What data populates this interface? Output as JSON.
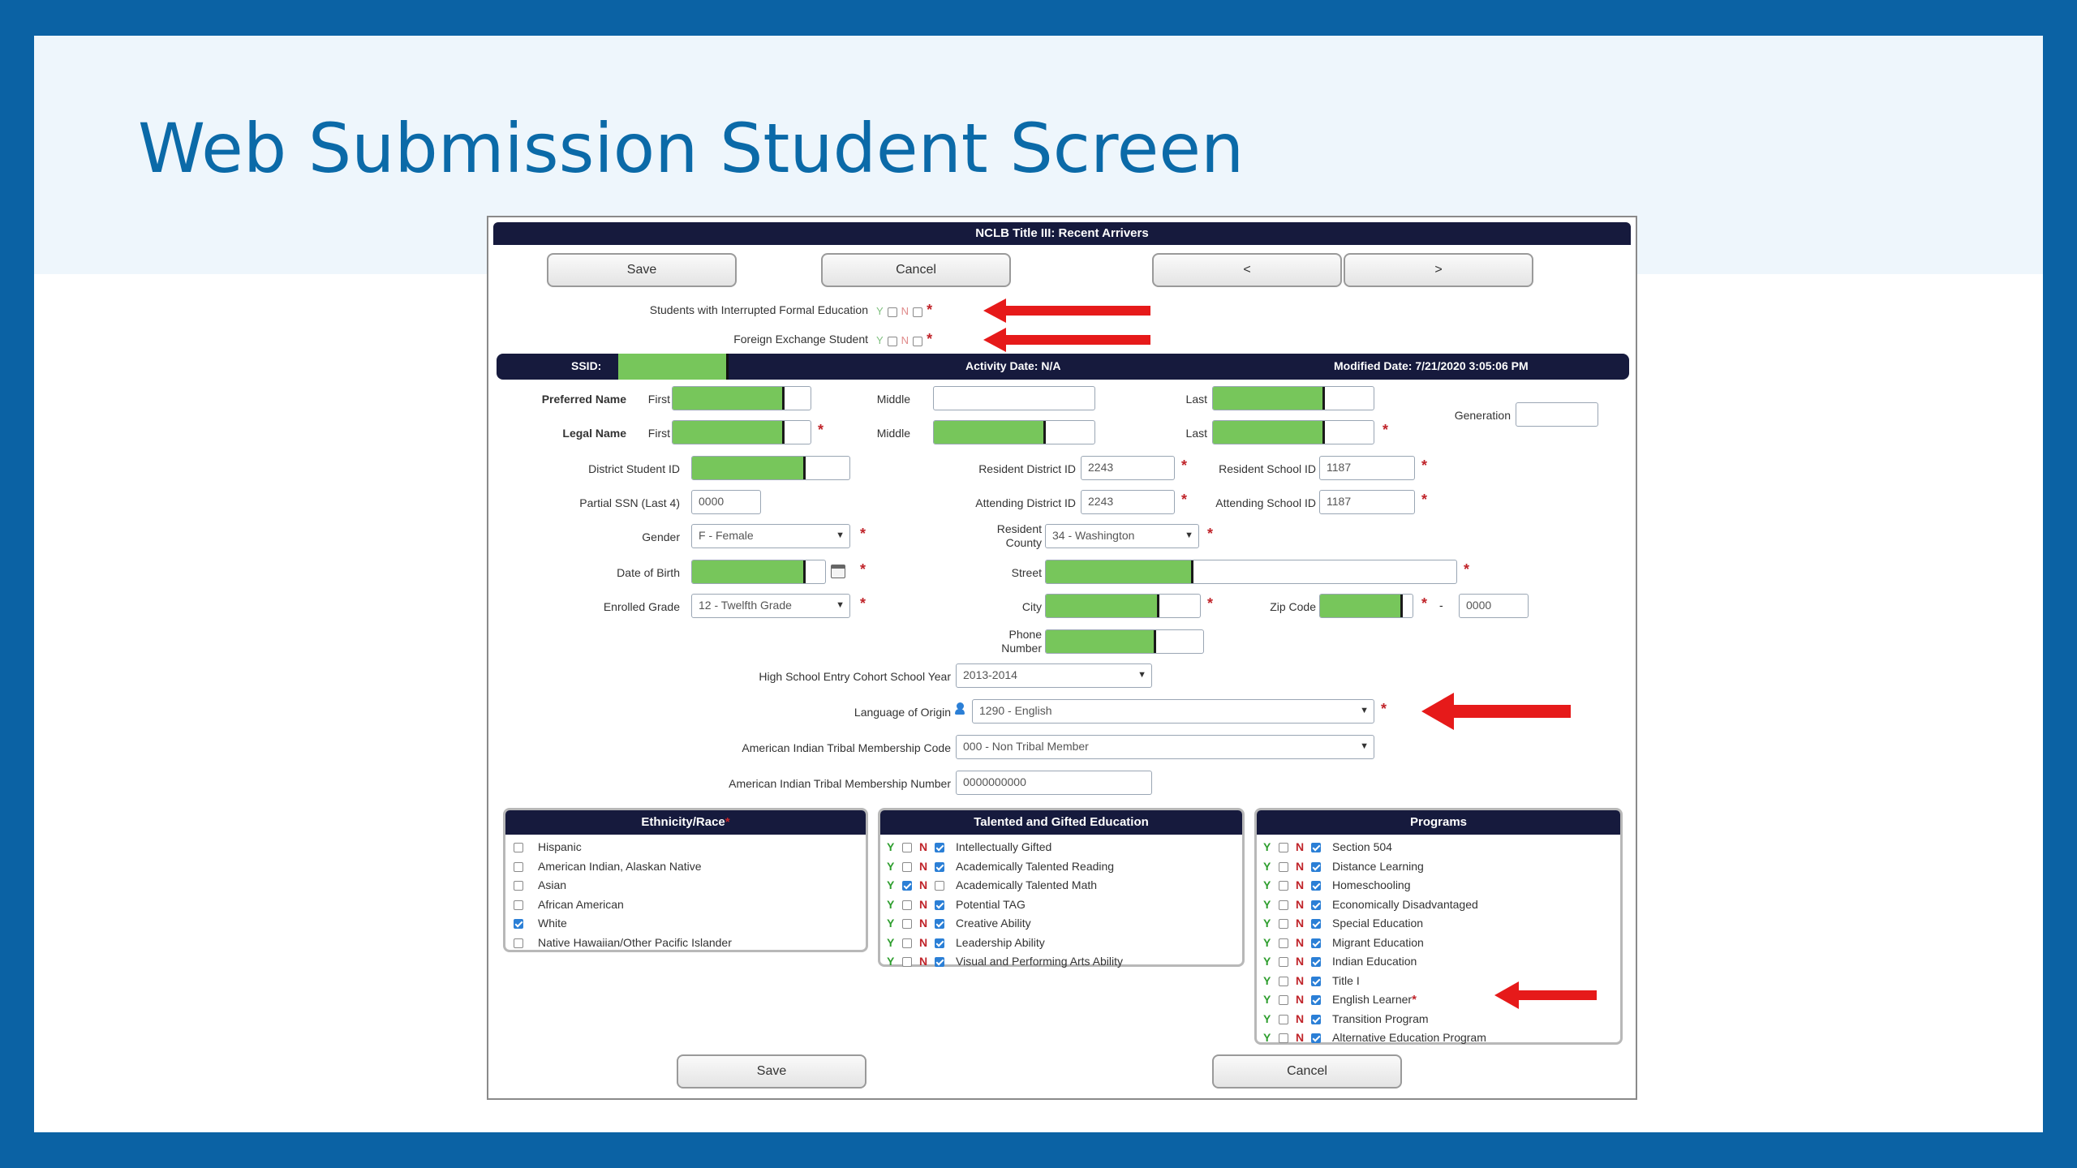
{
  "slide": {
    "title": "Web Submission Student Screen"
  },
  "form": {
    "title": "NCLB Title III: Recent Arrivers",
    "top_buttons": {
      "save": "Save",
      "cancel": "Cancel",
      "prev": "<",
      "next": ">"
    },
    "flags": [
      {
        "label": "Students with Interrupted Formal Education",
        "y": "Y",
        "n": "N",
        "req": "*"
      },
      {
        "label": "Foreign Exchange Student",
        "y": "Y",
        "n": "N",
        "req": "*"
      }
    ],
    "infobar": {
      "ssid_label": "SSID:",
      "activity_date": "Activity Date: N/A",
      "modified_date": "Modified Date: 7/21/2020 3:05:06 PM"
    },
    "fields": {
      "preferred_name_label": "Preferred Name",
      "legal_name_label": "Legal Name",
      "first": "First",
      "middle": "Middle",
      "last": "Last",
      "generation": "Generation",
      "district_student_id": "District Student ID",
      "partial_ssn": "Partial SSN (Last 4)",
      "partial_ssn_value": "0000",
      "gender": "Gender",
      "gender_value": "F - Female",
      "dob": "Date of Birth",
      "enrolled_grade": "Enrolled Grade",
      "enrolled_grade_value": "12 - Twelfth Grade",
      "resident_district_id": "Resident District ID",
      "resident_district_id_value": "2243",
      "attending_district_id": "Attending District ID",
      "attending_district_id_value": "2243",
      "resident_county_1": "Resident",
      "resident_county_2": "County",
      "resident_county_value": "34 - Washington",
      "street": "Street",
      "city": "City",
      "phone_1": "Phone",
      "phone_2": "Number",
      "resident_school_id": "Resident School ID",
      "resident_school_id_value": "1187",
      "attending_school_id": "Attending School ID",
      "attending_school_id_value": "1187",
      "zip_code": "Zip Code",
      "zip_dash": "-",
      "zip_ext_value": "0000",
      "hs_cohort": "High School Entry Cohort School Year",
      "hs_cohort_value": "2013-2014",
      "language": "Language of Origin",
      "language_value": "1290 - English",
      "tribal_code": "American Indian Tribal Membership Code",
      "tribal_code_value": "000 - Non Tribal Member",
      "tribal_number": "American Indian Tribal Membership Number",
      "tribal_number_value": "0000000000",
      "req": "*"
    },
    "ethnicity": {
      "title": "Ethnicity/Race",
      "req": "*",
      "items": [
        {
          "label": "Hispanic",
          "checked": false
        },
        {
          "label": "American Indian, Alaskan Native",
          "checked": false
        },
        {
          "label": "Asian",
          "checked": false
        },
        {
          "label": "African American",
          "checked": false
        },
        {
          "label": "White",
          "checked": true
        },
        {
          "label": "Native Hawaiian/Other Pacific Islander",
          "checked": false
        }
      ]
    },
    "tag": {
      "title": "Talented and Gifted Education",
      "items": [
        {
          "label": "Intellectually Gifted",
          "y": false,
          "n": true
        },
        {
          "label": "Academically Talented Reading",
          "y": false,
          "n": true
        },
        {
          "label": "Academically Talented Math",
          "y": true,
          "n": false
        },
        {
          "label": "Potential TAG",
          "y": false,
          "n": true
        },
        {
          "label": "Creative Ability",
          "y": false,
          "n": true
        },
        {
          "label": "Leadership Ability",
          "y": false,
          "n": true
        },
        {
          "label": "Visual and Performing Arts Ability",
          "y": false,
          "n": true
        }
      ]
    },
    "programs": {
      "title": "Programs",
      "items": [
        {
          "label": "Section 504",
          "y": false,
          "n": true
        },
        {
          "label": "Distance Learning",
          "y": false,
          "n": true
        },
        {
          "label": "Homeschooling",
          "y": false,
          "n": true
        },
        {
          "label": "Economically Disadvantaged",
          "y": false,
          "n": true
        },
        {
          "label": "Special Education",
          "y": false,
          "n": true
        },
        {
          "label": "Migrant Education",
          "y": false,
          "n": true
        },
        {
          "label": "Indian Education",
          "y": false,
          "n": true
        },
        {
          "label": "Title I",
          "y": false,
          "n": true
        },
        {
          "label": "English Learner",
          "y": false,
          "n": true,
          "req": "*"
        },
        {
          "label": "Transition Program",
          "y": false,
          "n": true
        },
        {
          "label": "Alternative Education Program",
          "y": false,
          "n": true
        }
      ]
    },
    "yn": {
      "y": "Y",
      "n": "N"
    },
    "bottom_buttons": {
      "save": "Save",
      "cancel": "Cancel"
    }
  },
  "colors": {
    "brand": "#0b62a4",
    "header": "#161a3d",
    "mask": "#77c65b",
    "arrow": "#e61a1a",
    "required": "#c0242a"
  }
}
